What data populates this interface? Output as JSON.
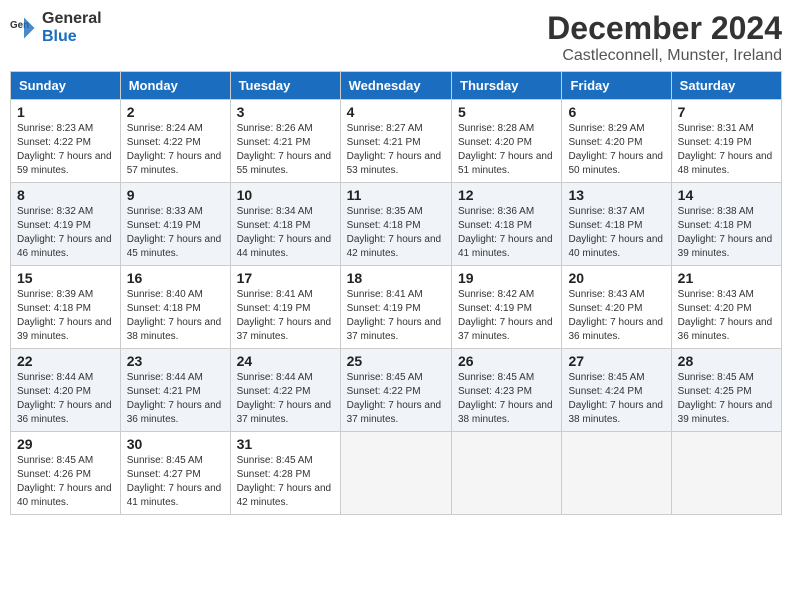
{
  "header": {
    "logo_general": "General",
    "logo_blue": "Blue",
    "month": "December 2024",
    "location": "Castleconnell, Munster, Ireland"
  },
  "days_of_week": [
    "Sunday",
    "Monday",
    "Tuesday",
    "Wednesday",
    "Thursday",
    "Friday",
    "Saturday"
  ],
  "weeks": [
    [
      {
        "day": "1",
        "sunrise": "8:23 AM",
        "sunset": "4:22 PM",
        "daylight": "7 hours and 59 minutes."
      },
      {
        "day": "2",
        "sunrise": "8:24 AM",
        "sunset": "4:22 PM",
        "daylight": "7 hours and 57 minutes."
      },
      {
        "day": "3",
        "sunrise": "8:26 AM",
        "sunset": "4:21 PM",
        "daylight": "7 hours and 55 minutes."
      },
      {
        "day": "4",
        "sunrise": "8:27 AM",
        "sunset": "4:21 PM",
        "daylight": "7 hours and 53 minutes."
      },
      {
        "day": "5",
        "sunrise": "8:28 AM",
        "sunset": "4:20 PM",
        "daylight": "7 hours and 51 minutes."
      },
      {
        "day": "6",
        "sunrise": "8:29 AM",
        "sunset": "4:20 PM",
        "daylight": "7 hours and 50 minutes."
      },
      {
        "day": "7",
        "sunrise": "8:31 AM",
        "sunset": "4:19 PM",
        "daylight": "7 hours and 48 minutes."
      }
    ],
    [
      {
        "day": "8",
        "sunrise": "8:32 AM",
        "sunset": "4:19 PM",
        "daylight": "7 hours and 46 minutes."
      },
      {
        "day": "9",
        "sunrise": "8:33 AM",
        "sunset": "4:19 PM",
        "daylight": "7 hours and 45 minutes."
      },
      {
        "day": "10",
        "sunrise": "8:34 AM",
        "sunset": "4:18 PM",
        "daylight": "7 hours and 44 minutes."
      },
      {
        "day": "11",
        "sunrise": "8:35 AM",
        "sunset": "4:18 PM",
        "daylight": "7 hours and 42 minutes."
      },
      {
        "day": "12",
        "sunrise": "8:36 AM",
        "sunset": "4:18 PM",
        "daylight": "7 hours and 41 minutes."
      },
      {
        "day": "13",
        "sunrise": "8:37 AM",
        "sunset": "4:18 PM",
        "daylight": "7 hours and 40 minutes."
      },
      {
        "day": "14",
        "sunrise": "8:38 AM",
        "sunset": "4:18 PM",
        "daylight": "7 hours and 39 minutes."
      }
    ],
    [
      {
        "day": "15",
        "sunrise": "8:39 AM",
        "sunset": "4:18 PM",
        "daylight": "7 hours and 39 minutes."
      },
      {
        "day": "16",
        "sunrise": "8:40 AM",
        "sunset": "4:18 PM",
        "daylight": "7 hours and 38 minutes."
      },
      {
        "day": "17",
        "sunrise": "8:41 AM",
        "sunset": "4:19 PM",
        "daylight": "7 hours and 37 minutes."
      },
      {
        "day": "18",
        "sunrise": "8:41 AM",
        "sunset": "4:19 PM",
        "daylight": "7 hours and 37 minutes."
      },
      {
        "day": "19",
        "sunrise": "8:42 AM",
        "sunset": "4:19 PM",
        "daylight": "7 hours and 37 minutes."
      },
      {
        "day": "20",
        "sunrise": "8:43 AM",
        "sunset": "4:20 PM",
        "daylight": "7 hours and 36 minutes."
      },
      {
        "day": "21",
        "sunrise": "8:43 AM",
        "sunset": "4:20 PM",
        "daylight": "7 hours and 36 minutes."
      }
    ],
    [
      {
        "day": "22",
        "sunrise": "8:44 AM",
        "sunset": "4:20 PM",
        "daylight": "7 hours and 36 minutes."
      },
      {
        "day": "23",
        "sunrise": "8:44 AM",
        "sunset": "4:21 PM",
        "daylight": "7 hours and 36 minutes."
      },
      {
        "day": "24",
        "sunrise": "8:44 AM",
        "sunset": "4:22 PM",
        "daylight": "7 hours and 37 minutes."
      },
      {
        "day": "25",
        "sunrise": "8:45 AM",
        "sunset": "4:22 PM",
        "daylight": "7 hours and 37 minutes."
      },
      {
        "day": "26",
        "sunrise": "8:45 AM",
        "sunset": "4:23 PM",
        "daylight": "7 hours and 38 minutes."
      },
      {
        "day": "27",
        "sunrise": "8:45 AM",
        "sunset": "4:24 PM",
        "daylight": "7 hours and 38 minutes."
      },
      {
        "day": "28",
        "sunrise": "8:45 AM",
        "sunset": "4:25 PM",
        "daylight": "7 hours and 39 minutes."
      }
    ],
    [
      {
        "day": "29",
        "sunrise": "8:45 AM",
        "sunset": "4:26 PM",
        "daylight": "7 hours and 40 minutes."
      },
      {
        "day": "30",
        "sunrise": "8:45 AM",
        "sunset": "4:27 PM",
        "daylight": "7 hours and 41 minutes."
      },
      {
        "day": "31",
        "sunrise": "8:45 AM",
        "sunset": "4:28 PM",
        "daylight": "7 hours and 42 minutes."
      },
      null,
      null,
      null,
      null
    ]
  ]
}
